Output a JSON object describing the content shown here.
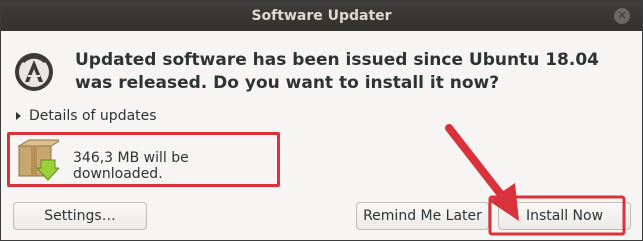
{
  "window": {
    "title": "Software Updater",
    "close_glyph": "✕"
  },
  "dialog": {
    "headline": "Updated software has been issued since Ubuntu 18.04 was released. Do you want to install it now?",
    "details_label": "Details of updates",
    "download_size_text": "346,3 MB will be downloaded."
  },
  "buttons": {
    "settings": "Settings…",
    "remind": "Remind Me Later",
    "install": "Install Now"
  },
  "icons": {
    "app": "software-updater-icon",
    "package": "package-download-icon",
    "expander": "expander-triangle-icon",
    "close": "close-icon"
  },
  "colors": {
    "annotation_red": "#d9323a",
    "titlebar": "#3e3d39"
  }
}
